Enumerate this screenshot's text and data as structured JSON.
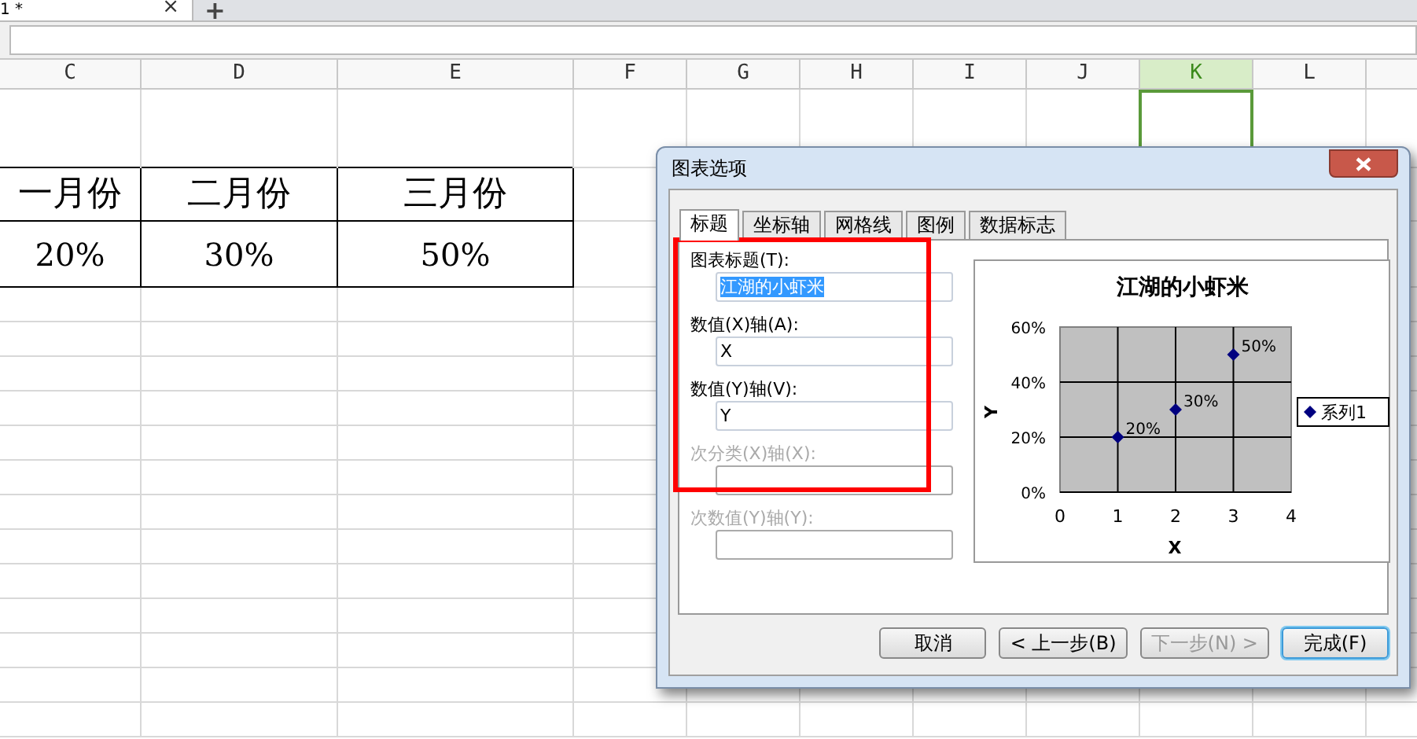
{
  "sheet_tab": {
    "label": "1 *",
    "close": "×",
    "add": "+"
  },
  "columns": [
    {
      "label": "C",
      "selected": false
    },
    {
      "label": "D",
      "selected": false
    },
    {
      "label": "E",
      "selected": false
    },
    {
      "label": "F",
      "selected": false
    },
    {
      "label": "G",
      "selected": false
    },
    {
      "label": "H",
      "selected": false
    },
    {
      "label": "I",
      "selected": false
    },
    {
      "label": "J",
      "selected": false
    },
    {
      "label": "K",
      "selected": true
    },
    {
      "label": "L",
      "selected": false
    }
  ],
  "table": {
    "rows": [
      [
        "一月份",
        "二月份",
        "三月份"
      ],
      [
        "20%",
        "30%",
        "50%"
      ]
    ]
  },
  "dialog": {
    "title": "图表选项",
    "tabs": [
      {
        "label": "标题",
        "selected": true
      },
      {
        "label": "坐标轴",
        "selected": false
      },
      {
        "label": "网格线",
        "selected": false
      },
      {
        "label": "图例",
        "selected": false
      },
      {
        "label": "数据标志",
        "selected": false
      }
    ],
    "fields": [
      {
        "label": "图表标题(T):",
        "value": "江湖的小虾米",
        "disabled": false,
        "text_selected": true
      },
      {
        "label": "数值(X)轴(A):",
        "value": "X",
        "disabled": false,
        "text_selected": false
      },
      {
        "label": "数值(Y)轴(V):",
        "value": "Y",
        "disabled": false,
        "text_selected": false
      },
      {
        "label": "次分类(X)轴(X):",
        "disabled": true
      },
      {
        "label": "次数值(Y)轴(Y):",
        "disabled": true
      }
    ],
    "chart_data": {
      "type": "scatter",
      "grid": true,
      "title": "江湖的小虾米",
      "xlabel": "X",
      "ylabel": "Y",
      "xlim": [
        0,
        4
      ],
      "ylim": [
        0,
        0.6
      ],
      "xticks": [
        0,
        1,
        2,
        3,
        4
      ],
      "yticks": [
        {
          "value": 0,
          "label": "0%"
        },
        {
          "value": 0.2,
          "label": "20%"
        },
        {
          "value": 0.4,
          "label": "40%"
        },
        {
          "value": 0.6,
          "label": "60%"
        }
      ],
      "series": [
        {
          "name": "系列1",
          "color": "#000080",
          "x": [
            1,
            2,
            3
          ],
          "values": [
            0.2,
            0.3,
            0.5
          ],
          "value_labels": [
            "20%",
            "30%",
            "50%"
          ]
        }
      ]
    },
    "buttons": [
      {
        "label": "取消",
        "disabled": false,
        "default": false
      },
      {
        "label": "< 上一步(B)",
        "disabled": false,
        "default": false
      },
      {
        "label": "下一步(N) >",
        "disabled": true,
        "default": false
      },
      {
        "label": "完成(F)",
        "disabled": false,
        "default": true
      }
    ]
  }
}
